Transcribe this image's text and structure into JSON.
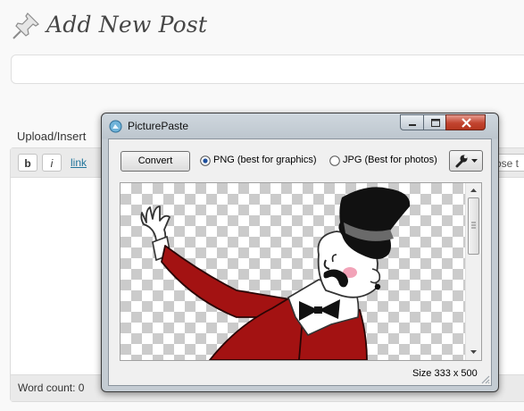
{
  "page": {
    "title": "Add New Post",
    "upload_label": "Upload/Insert",
    "title_placeholder": ""
  },
  "editor": {
    "toolbar": {
      "bold": "b",
      "italic": "i",
      "link": "link",
      "close_tags": "ose t"
    },
    "word_count": "Word count: 0"
  },
  "picturepaste": {
    "title": "PicturePaste",
    "convert_label": "Convert",
    "format_options": [
      {
        "label": "PNG (best for graphics)",
        "selected": true
      },
      {
        "label": "JPG (Best for photos)",
        "selected": false
      }
    ],
    "size_text": "Size 333 x 500"
  },
  "icons": [
    "pushpin-icon",
    "picturepaste-app-icon",
    "minimize-icon",
    "maximize-icon",
    "close-icon",
    "wrench-icon",
    "dropdown-arrow-icon",
    "scroll-up-icon",
    "scroll-down-icon",
    "resize-grip-icon"
  ],
  "colors": {
    "title_text": "#464646",
    "link": "#21759b",
    "close_button": "#c2442f",
    "coat_red": "#a31212",
    "checker": "#cbcbcb"
  }
}
